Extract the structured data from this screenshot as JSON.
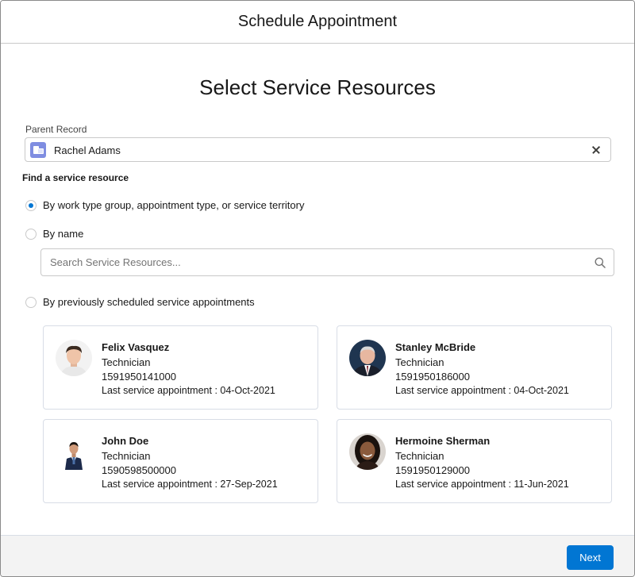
{
  "modal": {
    "title": "Schedule Appointment"
  },
  "page": {
    "title": "Select Service Resources"
  },
  "parent_record": {
    "label": "Parent Record",
    "value": "Rachel Adams",
    "icon": "account-icon",
    "accent": "#7f8de1"
  },
  "finder": {
    "label": "Find a service resource",
    "options": [
      {
        "label": "By work type group, appointment type, or service territory",
        "checked": true
      },
      {
        "label": "By name",
        "checked": false
      },
      {
        "label": "By previously scheduled service appointments",
        "checked": false
      }
    ],
    "search": {
      "placeholder": "Search Service Resources...",
      "value": ""
    }
  },
  "resources": [
    {
      "name": "Felix Vasquez",
      "role": "Technician",
      "phone": "1591950141000",
      "last": "Last service appointment : 04-Oct-2021"
    },
    {
      "name": "Stanley McBride",
      "role": "Technician",
      "phone": "1591950186000",
      "last": "Last service appointment : 04-Oct-2021"
    },
    {
      "name": "John Doe",
      "role": "Technician",
      "phone": "1590598500000",
      "last": "Last service appointment : 27-Sep-2021"
    },
    {
      "name": "Hermoine Sherman",
      "role": "Technician",
      "phone": "1591950129000",
      "last": "Last service appointment : 11-Jun-2021"
    }
  ],
  "footer": {
    "next_label": "Next"
  },
  "colors": {
    "brand": "#0176d3",
    "border": "#c9c9c9",
    "footer_bg": "#f3f3f3"
  }
}
